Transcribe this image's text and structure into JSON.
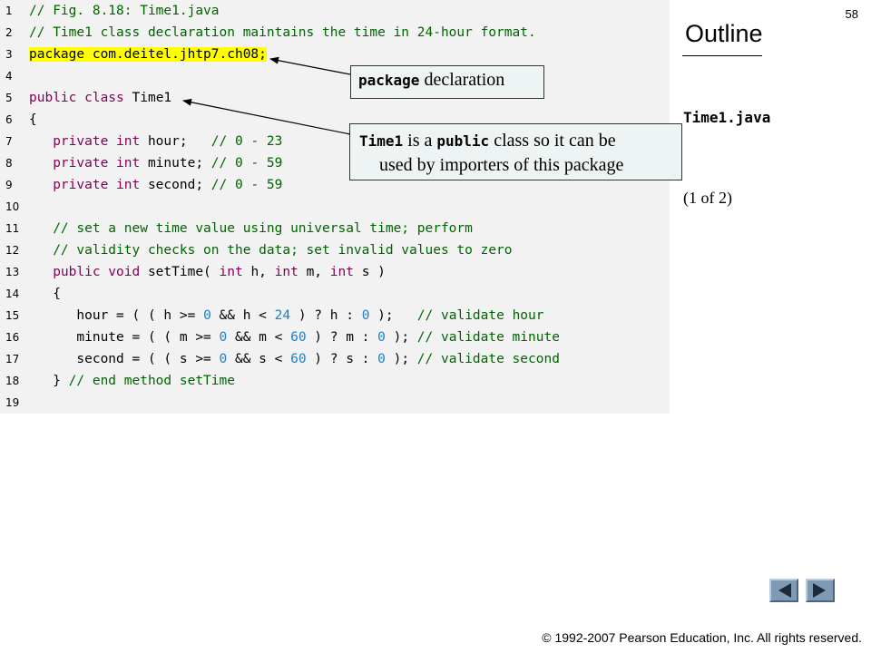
{
  "page_number": "58",
  "outline": {
    "title": "Outline",
    "file": "Time1.java",
    "part": "(1 of 2)"
  },
  "code_lines": [
    {
      "n": "1",
      "tokens": [
        {
          "t": "// Fig. 8.18: Time1.java",
          "c": "cm"
        }
      ]
    },
    {
      "n": "2",
      "tokens": [
        {
          "t": "// Time1 class declaration maintains the time in 24-hour format.",
          "c": "cm"
        }
      ]
    },
    {
      "n": "3",
      "tokens": [
        {
          "t": "package com.deitel.jhtp7.ch08;",
          "c": "pl",
          "hl": true
        }
      ]
    },
    {
      "n": "4",
      "tokens": []
    },
    {
      "n": "5",
      "tokens": [
        {
          "t": "public class ",
          "c": "kw"
        },
        {
          "t": "Time1",
          "c": "pl"
        }
      ]
    },
    {
      "n": "6",
      "tokens": [
        {
          "t": "{",
          "c": "pl"
        }
      ]
    },
    {
      "n": "7",
      "tokens": [
        {
          "t": "   private int ",
          "c": "kw"
        },
        {
          "t": "hour;   ",
          "c": "pl"
        },
        {
          "t": "// 0 - 23",
          "c": "cm"
        }
      ]
    },
    {
      "n": "8",
      "tokens": [
        {
          "t": "   private int ",
          "c": "kw"
        },
        {
          "t": "minute; ",
          "c": "pl"
        },
        {
          "t": "// 0 - 59",
          "c": "cm"
        }
      ]
    },
    {
      "n": "9",
      "tokens": [
        {
          "t": "   private int ",
          "c": "kw"
        },
        {
          "t": "second; ",
          "c": "pl"
        },
        {
          "t": "// 0 - 59",
          "c": "cm"
        }
      ]
    },
    {
      "n": "10",
      "tokens": []
    },
    {
      "n": "11",
      "tokens": [
        {
          "t": "   // set a new time value using universal time; perform",
          "c": "cm"
        }
      ]
    },
    {
      "n": "12",
      "tokens": [
        {
          "t": "   // validity checks on the data; set invalid values to zero",
          "c": "cm"
        }
      ]
    },
    {
      "n": "13",
      "tokens": [
        {
          "t": "   public void ",
          "c": "kw"
        },
        {
          "t": "setTime( ",
          "c": "pl"
        },
        {
          "t": "int ",
          "c": "kw"
        },
        {
          "t": "h, ",
          "c": "pl"
        },
        {
          "t": "int ",
          "c": "kw"
        },
        {
          "t": "m, ",
          "c": "pl"
        },
        {
          "t": "int ",
          "c": "kw"
        },
        {
          "t": "s )",
          "c": "pl"
        }
      ]
    },
    {
      "n": "14",
      "tokens": [
        {
          "t": "   {",
          "c": "pl"
        }
      ]
    },
    {
      "n": "15",
      "tokens": [
        {
          "t": "      hour = ( ( h >= ",
          "c": "pl"
        },
        {
          "t": "0",
          "c": "num"
        },
        {
          "t": " && h < ",
          "c": "pl"
        },
        {
          "t": "24",
          "c": "num"
        },
        {
          "t": " ) ? h : ",
          "c": "pl"
        },
        {
          "t": "0",
          "c": "num"
        },
        {
          "t": " );   ",
          "c": "pl"
        },
        {
          "t": "// validate hour",
          "c": "cm"
        }
      ]
    },
    {
      "n": "16",
      "tokens": [
        {
          "t": "      minute = ( ( m >= ",
          "c": "pl"
        },
        {
          "t": "0",
          "c": "num"
        },
        {
          "t": " && m < ",
          "c": "pl"
        },
        {
          "t": "60",
          "c": "num"
        },
        {
          "t": " ) ? m : ",
          "c": "pl"
        },
        {
          "t": "0",
          "c": "num"
        },
        {
          "t": " ); ",
          "c": "pl"
        },
        {
          "t": "// validate minute",
          "c": "cm"
        }
      ]
    },
    {
      "n": "17",
      "tokens": [
        {
          "t": "      second = ( ( s >= ",
          "c": "pl"
        },
        {
          "t": "0",
          "c": "num"
        },
        {
          "t": " && s < ",
          "c": "pl"
        },
        {
          "t": "60",
          "c": "num"
        },
        {
          "t": " ) ? s : ",
          "c": "pl"
        },
        {
          "t": "0",
          "c": "num"
        },
        {
          "t": " ); ",
          "c": "pl"
        },
        {
          "t": "// validate second",
          "c": "cm"
        }
      ]
    },
    {
      "n": "18",
      "tokens": [
        {
          "t": "   } ",
          "c": "pl"
        },
        {
          "t": "// end method setTime",
          "c": "cm"
        }
      ]
    },
    {
      "n": "19",
      "tokens": []
    }
  ],
  "callouts": {
    "package": {
      "mono": "package",
      "text": " declaration"
    },
    "public_class": {
      "mono1": "Time1",
      "text1": " is a ",
      "mono2": "public",
      "text2": " class so it can be",
      "line2": "used by importers of this package"
    }
  },
  "nav": {
    "prev_icon": "triangle-left-icon",
    "next_icon": "triangle-right-icon"
  },
  "footer": "© 1992-2007 Pearson Education, Inc.  All rights reserved.",
  "colors": {
    "keyword": "#7f0055",
    "comment": "#006400",
    "number": "#1f7fbf",
    "highlight": "#ffff00",
    "code_background": "#f2f2f2",
    "nav_button": "#7e9ab5"
  }
}
